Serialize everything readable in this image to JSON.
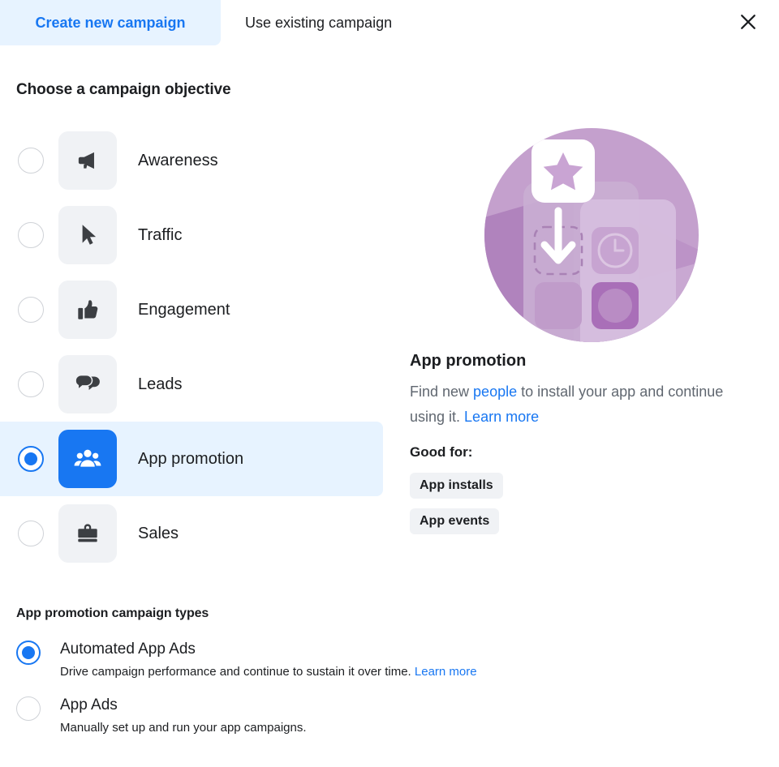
{
  "tabs": [
    {
      "label": "Create new campaign",
      "active": true
    },
    {
      "label": "Use existing campaign",
      "active": false
    }
  ],
  "close_icon": "close-icon",
  "objective_section": {
    "heading": "Choose a campaign objective",
    "options": [
      {
        "label": "Awareness",
        "icon": "megaphone-icon",
        "selected": false
      },
      {
        "label": "Traffic",
        "icon": "cursor-icon",
        "selected": false
      },
      {
        "label": "Engagement",
        "icon": "thumbs-up-icon",
        "selected": false
      },
      {
        "label": "Leads",
        "icon": "chat-bubbles-icon",
        "selected": false
      },
      {
        "label": "App promotion",
        "icon": "people-group-icon",
        "selected": true
      },
      {
        "label": "Sales",
        "icon": "briefcase-icon",
        "selected": false
      }
    ]
  },
  "detail": {
    "illustration": "app-install-illustration",
    "title": "App promotion",
    "description_part1": "Find new ",
    "description_link1": "people",
    "description_part2": " to install your app and continue using it. ",
    "description_link2": "Learn more",
    "good_for_label": "Good for:",
    "pills": [
      "App installs",
      "App events"
    ]
  },
  "campaign_types": {
    "heading": "App promotion campaign types",
    "options": [
      {
        "title": "Automated App Ads",
        "description": "Drive campaign performance and continue to sustain it over time. ",
        "link": "Learn more",
        "selected": true
      },
      {
        "title": "App Ads",
        "description": "Manually set up and run your app campaigns.",
        "link": "",
        "selected": false
      }
    ]
  },
  "colors": {
    "accent_blue": "#1877f2",
    "tab_active_bg": "#e7f3ff",
    "tile_grey": "#f0f2f5",
    "text_primary": "#1c1e21",
    "text_secondary": "#606770",
    "illustration_purple": "#b98cc4"
  }
}
